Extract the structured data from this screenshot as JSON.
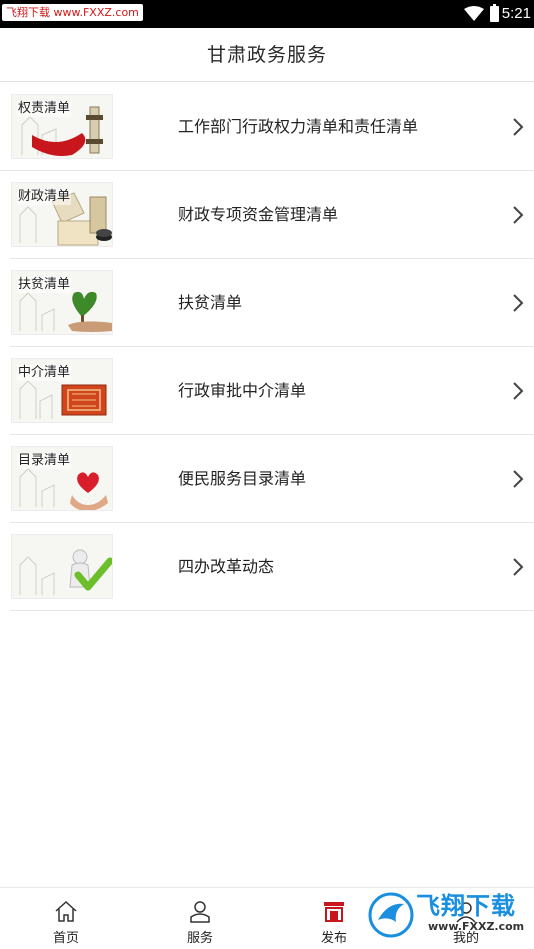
{
  "status_bar": {
    "watermark_badge": "飞翔下载 www.FXXZ.com",
    "time": "5:21"
  },
  "header": {
    "title": "甘肃政务服务"
  },
  "list": {
    "items": [
      {
        "thumb_label": "权责清单",
        "label": "工作部门行政权力清单和责任清单",
        "thumb_icon": "gavel-scroll-image"
      },
      {
        "thumb_label": "财政清单",
        "label": "财政专项资金管理清单",
        "thumb_icon": "coins-stack-image"
      },
      {
        "thumb_label": "扶贫清单",
        "label": "扶贫清单",
        "thumb_icon": "hand-tree-image"
      },
      {
        "thumb_label": "中介清单",
        "label": "行政审批中介清单",
        "thumb_icon": "seal-stamp-image"
      },
      {
        "thumb_label": "目录清单",
        "label": "便民服务目录清单",
        "thumb_icon": "hands-heart-image"
      },
      {
        "thumb_label": "",
        "label": "四办改革动态",
        "thumb_icon": "checkmark-person-image"
      }
    ]
  },
  "tab_bar": {
    "tabs": [
      {
        "label": "首页",
        "icon": "home-icon"
      },
      {
        "label": "服务",
        "icon": "person-icon"
      },
      {
        "label": "发布",
        "icon": "publish-icon",
        "active": true
      },
      {
        "label": "我的",
        "icon": "user-icon"
      }
    ]
  },
  "watermark_logo": {
    "text": "飞翔下载",
    "url": "www.FXXZ.com"
  },
  "colors": {
    "accent_red": "#c8161d",
    "text": "#222222",
    "divider": "#e8e8e8",
    "watermark_blue": "#1a8fe0"
  }
}
